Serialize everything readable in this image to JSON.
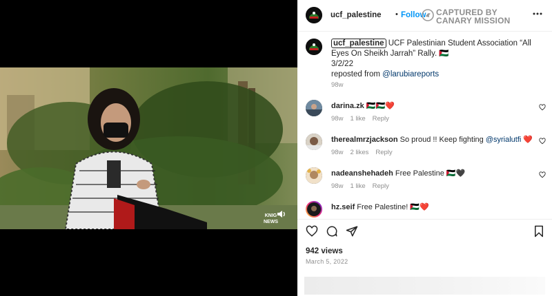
{
  "post_author": {
    "username": "ucf_palestine",
    "follow_label": "Follow",
    "separator": "•"
  },
  "watermark": {
    "line1": "CAPTURED BY",
    "line2": "CANARY MISSION"
  },
  "video_overlay": {
    "line1": "KNIG",
    "line2": "NEWS"
  },
  "caption": {
    "username": "ucf_palestine",
    "text": "UCF Palestinian Student Association “All Eyes On Sheikh Jarrah” Rally. 🇵🇸",
    "date_line": "3/2/22",
    "repost_prefix": "reposted from ",
    "repost_handle": "@larubiareports",
    "age": "98w"
  },
  "comments": [
    {
      "username": "darina.zk",
      "text": "🇵🇸🇵🇸❤️",
      "mention": "",
      "suffix": "",
      "age": "98w",
      "likes": "1 like",
      "reply": "Reply"
    },
    {
      "username": "therealmrzjackson",
      "text": "So proud !! Keep fighting ",
      "mention": "@syrialutfi",
      "suffix": " ❤️",
      "age": "98w",
      "likes": "2 likes",
      "reply": "Reply"
    },
    {
      "username": "nadeanshehadeh",
      "text": "Free Palestine 🇵🇸🖤",
      "mention": "",
      "suffix": "",
      "age": "98w",
      "likes": "1 like",
      "reply": "Reply"
    },
    {
      "username": "hz.seif",
      "text": "Free Palestine! 🇵🇸❤️",
      "mention": "",
      "suffix": "",
      "age": "",
      "likes": "",
      "reply": ""
    }
  ],
  "stats": {
    "views": "942 views",
    "date": "March 5, 2022"
  },
  "icons": [
    "heart-icon",
    "comment-icon",
    "share-icon",
    "bookmark-icon",
    "more-icon",
    "sound-icon"
  ],
  "colors": {
    "follow": "#0095f6",
    "link": "#00376b",
    "muted": "#8e8e8e",
    "heart_red": "#ed1c24"
  }
}
